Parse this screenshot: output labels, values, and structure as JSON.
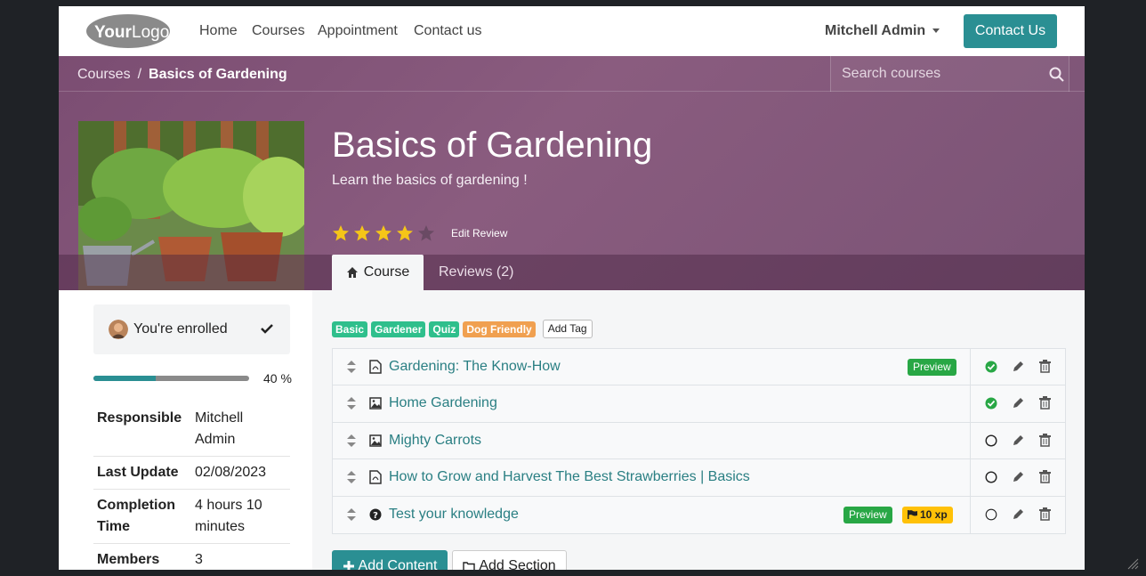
{
  "navbar": {
    "logo_text": "YourLogo",
    "links": [
      "Home",
      "Courses",
      "Appointment",
      "Contact us"
    ],
    "user_name": "Mitchell Admin",
    "contact_button": "Contact Us"
  },
  "breadcrumb": {
    "parent": "Courses",
    "separator": "/",
    "current": "Basics of Gardening"
  },
  "search": {
    "placeholder": "Search courses"
  },
  "course": {
    "title": "Basics of Gardening",
    "subtitle": "Learn the basics of gardening !",
    "rating": 4,
    "rating_max": 5,
    "edit_review": "Edit Review"
  },
  "tabs": {
    "course": "Course",
    "reviews": "Reviews (2)"
  },
  "sidebar": {
    "enrolled_text": "You're enrolled",
    "progress_percent": 40,
    "progress_label": "40 %",
    "info": [
      {
        "key": "Responsible",
        "value": "Mitchell Admin"
      },
      {
        "key": "Last Update",
        "value": "02/08/2023"
      },
      {
        "key": "Completion Time",
        "value": "4 hours 10 minutes"
      },
      {
        "key": "Members",
        "value": "3"
      }
    ]
  },
  "tags": [
    {
      "label": "Basic",
      "color": "#2fbf8c"
    },
    {
      "label": "Gardener",
      "color": "#2fbf8c"
    },
    {
      "label": "Quiz",
      "color": "#2fbf8c"
    },
    {
      "label": "Dog Friendly",
      "color": "#f0a050"
    }
  ],
  "add_tag": "Add Tag",
  "contents": [
    {
      "title": "Gardening: The Know-How",
      "type": "pdf",
      "preview": "Preview",
      "xp": "",
      "completed": true
    },
    {
      "title": "Home Gardening",
      "type": "image",
      "preview": "",
      "xp": "",
      "completed": true
    },
    {
      "title": "Mighty Carrots",
      "type": "image",
      "preview": "",
      "xp": "",
      "completed": false
    },
    {
      "title": "How to Grow and Harvest The Best Strawberries | Basics",
      "type": "pdf",
      "preview": "",
      "xp": "",
      "completed": false
    },
    {
      "title": "Test your knowledge",
      "type": "quiz",
      "preview": "Preview",
      "xp": "10 xp",
      "completed": false
    }
  ],
  "buttons": {
    "add_content": "Add Content",
    "add_section": "Add Section"
  },
  "colors": {
    "accent": "#2a8f93",
    "hero": "#7b4d72",
    "success": "#28a745",
    "xp": "#ffc107",
    "link": "#2a7f83"
  }
}
